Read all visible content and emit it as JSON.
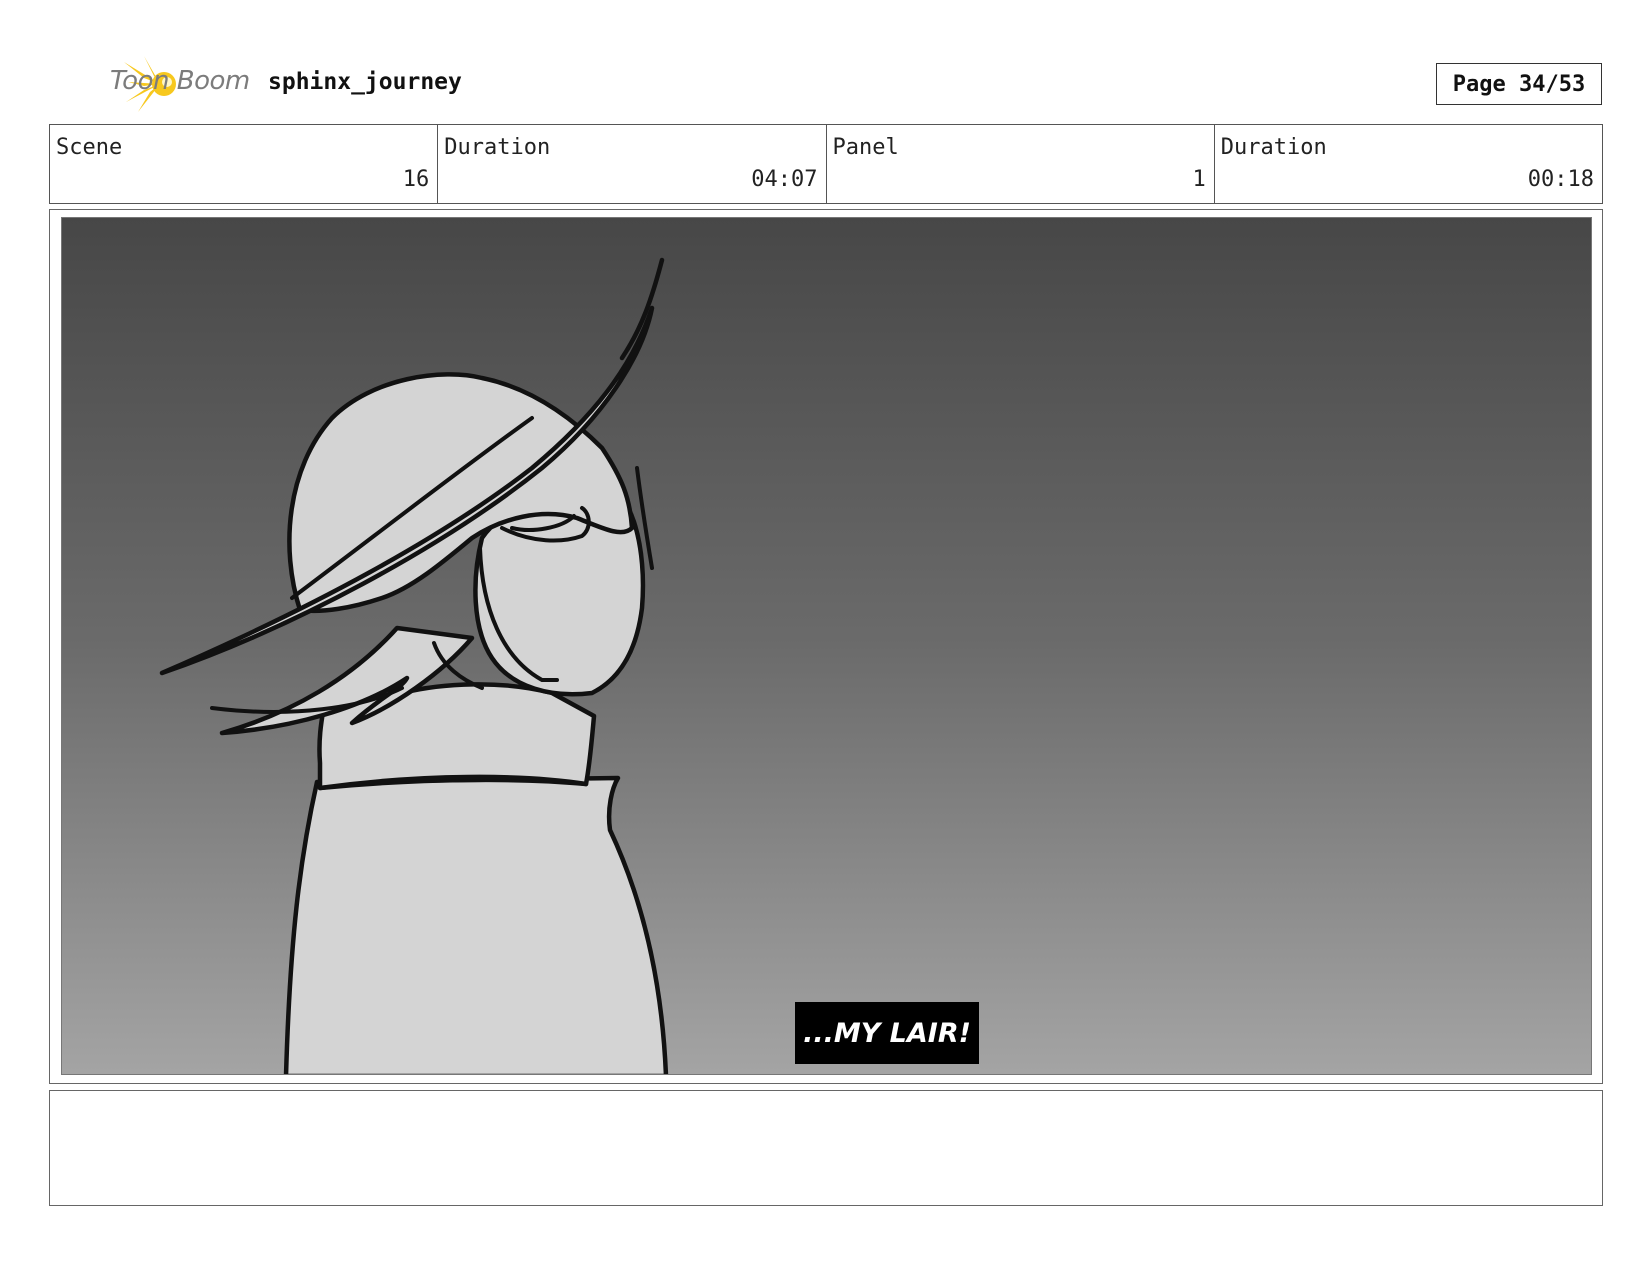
{
  "header": {
    "logo_text": "Toon Boom",
    "project_title": "sphinx_journey",
    "page_label": "Page 34/53"
  },
  "info": {
    "scene_label": "Scene",
    "scene_value": "16",
    "scene_duration_label": "Duration",
    "scene_duration_value": "04:07",
    "panel_label": "Panel",
    "panel_value": "1",
    "panel_duration_label": "Duration",
    "panel_duration_value": "00:18"
  },
  "panel": {
    "caption": "...MY LAIR!"
  },
  "notes": {
    "text": ""
  },
  "colors": {
    "logo_yellow": "#f7c81e",
    "logo_grey": "#7c7c7c",
    "sketch_fill": "#d4d4d4",
    "sketch_line": "#111111"
  }
}
